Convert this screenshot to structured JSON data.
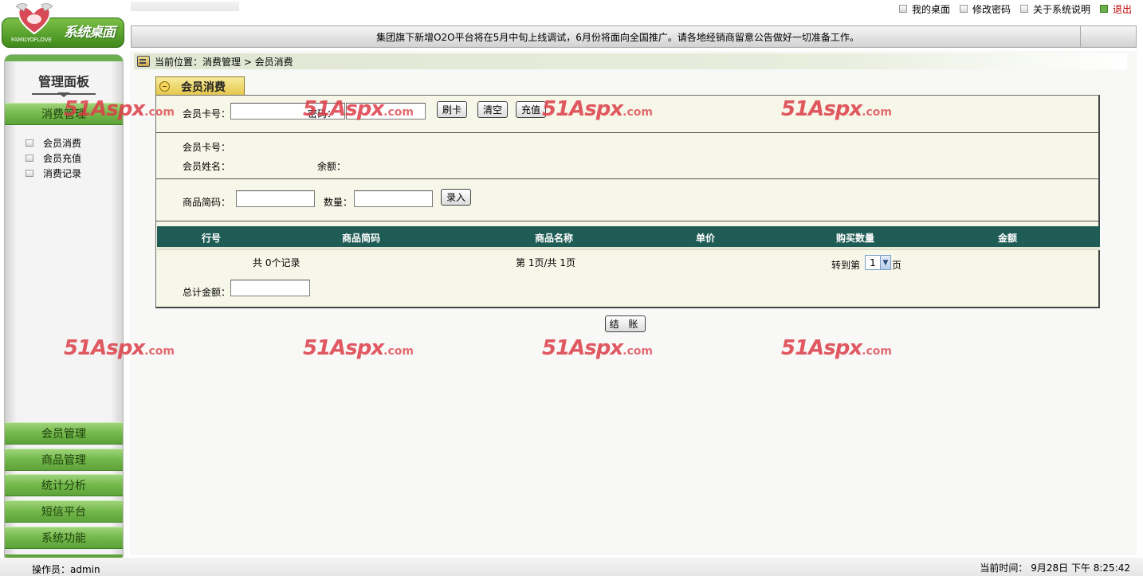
{
  "header": {
    "logo_text": "系统桌面",
    "logo_sub": "FAMILYOFLOVE",
    "links": [
      {
        "label": "我的桌面"
      },
      {
        "label": "修改密码"
      },
      {
        "label": "关于系统说明"
      },
      {
        "label": "退出"
      }
    ],
    "notice": "集团旗下新增O2O平台将在5月中旬上线调试，6月份将面向全国推广。请各地经销商留意公告做好一切准备工作。"
  },
  "sidebar": {
    "panel_title": "管理面板",
    "active_section": "消费管理",
    "sub_items": [
      {
        "label": "会员消费"
      },
      {
        "label": "会员充值"
      },
      {
        "label": "消费记录"
      }
    ],
    "sections": [
      {
        "label": "会员管理"
      },
      {
        "label": "商品管理"
      },
      {
        "label": "统计分析"
      },
      {
        "label": "短信平台"
      },
      {
        "label": "系统功能"
      }
    ]
  },
  "breadcrumb": "当前位置：消费管理 > 会员消费",
  "tab_title": "会员消费",
  "form": {
    "card_label": "会员卡号：",
    "card_value": "",
    "password_label": "密码：",
    "password_value": "",
    "swipe_button": "刷卡",
    "clear_button": "清空",
    "recharge_button": "充值",
    "info_card_label": "会员卡号：",
    "info_name_label": "会员姓名：",
    "info_balance_label": "余额：",
    "code_label": "商品简码：",
    "code_value": "",
    "qty_label": "数量：",
    "qty_value": "",
    "enter_button": "录入"
  },
  "grid": {
    "columns": [
      "行号",
      "商品简码",
      "商品名称",
      "单价",
      "购买数量",
      "金额"
    ],
    "rows": []
  },
  "pager": {
    "records": "共 0个记录",
    "page_info": "第 1页/共 1页",
    "goto_label": "转到第",
    "goto_value": "1",
    "goto_suffix": "页"
  },
  "total_label": "总计金额：",
  "total_value": "",
  "checkout_button": "结 账",
  "watermark": {
    "main": "51Aspx",
    "suffix": ".com"
  },
  "footer": {
    "operator": "操作员：admin",
    "time": "当前时间： 9月28日 下午 8:25:42"
  }
}
